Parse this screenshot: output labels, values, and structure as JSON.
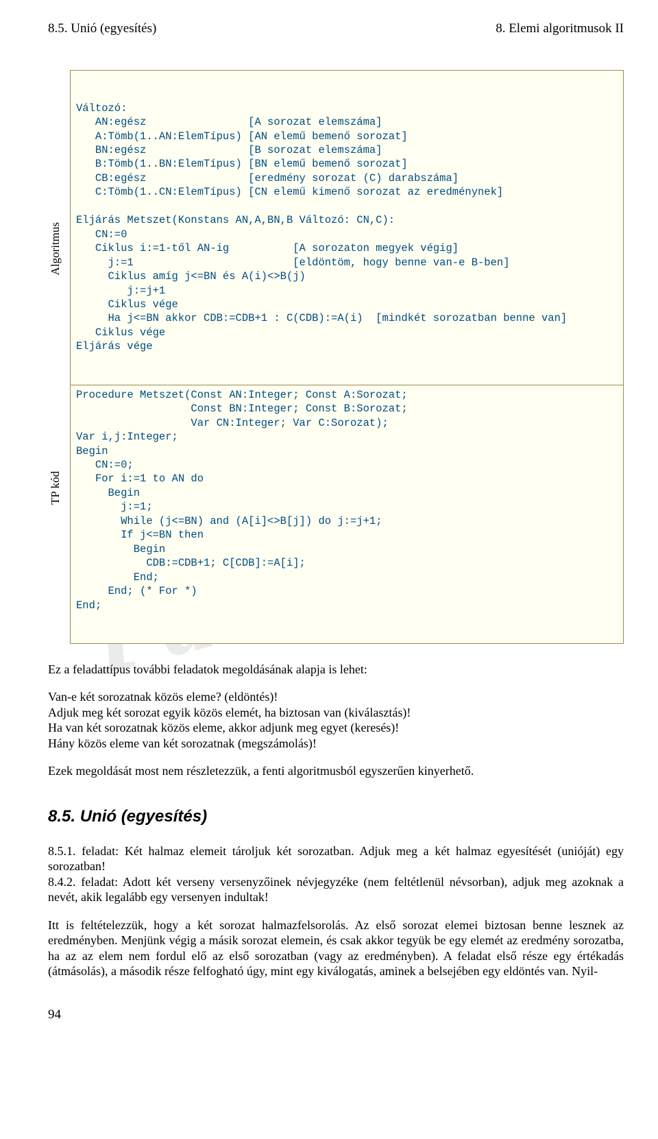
{
  "pageHeader": {
    "left": "8.5. Unió (egyesítés)",
    "right": "8. Elemi algoritmusok II"
  },
  "watermark": "Pásztor",
  "sideLabels": {
    "top": "Algoritmus",
    "bottom": "TP kód"
  },
  "algo": "Változó:\n   AN:egész                [A sorozat elemszáma]\n   A:Tömb(1..AN:ElemTípus) [AN elemű bemenő sorozat]\n   BN:egész                [B sorozat elemszáma]\n   B:Tömb(1..BN:ElemTípus) [BN elemű bemenő sorozat]\n   CB:egész                [eredmény sorozat (C) darabszáma]\n   C:Tömb(1..CN:ElemTípus) [CN elemű kimenő sorozat az eredménynek]\n\nEljárás Metszet(Konstans AN,A,BN,B Változó: CN,C):\n   CN:=0\n   Ciklus i:=1-től AN-ig          [A sorozaton megyek végig]\n     j:=1                         [eldöntöm, hogy benne van-e B-ben]\n     Ciklus amíg j<=BN és A(i)<>B(j)\n        j:=j+1\n     Ciklus vége\n     Ha j<=BN akkor CDB:=CDB+1 : C(CDB):=A(i)  [mindkét sorozatban benne van]\n   Ciklus vége\nEljárás vége",
  "tpcode": "Procedure Metszet(Const AN:Integer; Const A:Sorozat;\n                  Const BN:Integer; Const B:Sorozat;\n                  Var CN:Integer; Var C:Sorozat);\nVar i,j:Integer;\nBegin\n   CN:=0;\n   For i:=1 to AN do\n     Begin\n       j:=1;\n       While (j<=BN) and (A[i]<>B[j]) do j:=j+1;\n       If j<=BN then\n         Begin\n           CDB:=CDB+1; C[CDB]:=A[i];\n         End;\n     End; (* For *)\nEnd;",
  "para1": "Ez a feladattípus további feladatok megoldásának alapja is lehet:",
  "list1": "Van-e két sorozatnak közös eleme? (eldöntés)!",
  "list2": "Adjuk meg két sorozat egyik közös elemét, ha biztosan van (kiválasztás)!",
  "list3": "Ha van két sorozatnak közös eleme, akkor adjunk meg egyet (keresés)!",
  "list4": "Hány közös eleme van két sorozatnak (megszámolás)!",
  "para2": "Ezek megoldását most nem részletezzük, a fenti algoritmusból egyszerűen kinyerhető.",
  "h2": "8.5. Unió (egyesítés)",
  "para3": "8.5.1. feladat: Két halmaz elemeit tároljuk két sorozatban. Adjuk meg a két halmaz egyesítését (unióját) egy sorozatban!",
  "para4": "8.4.2. feladat: Adott két verseny versenyzőinek névjegyzéke (nem feltétlenül névsorban), adjuk meg azoknak a nevét, akik legalább egy versenyen indultak!",
  "para5": "Itt is feltételezzük, hogy a két sorozat halmazfelsorolás. Az első sorozat elemei biztosan benne lesznek az eredményben. Menjünk végig a másik sorozat elemein, és csak akkor tegyük be egy elemét az eredmény sorozatba, ha az az elem nem fordul elő az első sorozatban (vagy az eredményben). A feladat első része egy értékadás (átmásolás), a második része felfogható úgy, mint egy kiválogatás, aminek a belsejében egy eldöntés van. Nyil-",
  "pageNumber": "94"
}
